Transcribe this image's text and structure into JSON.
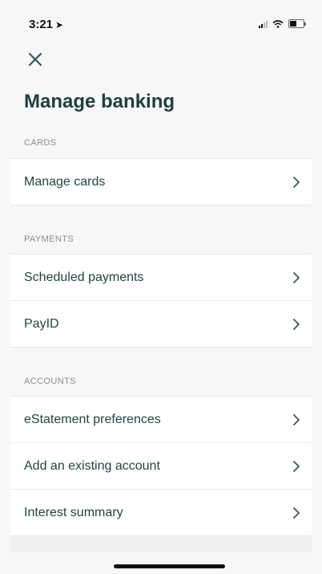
{
  "status_bar": {
    "time": "3:21",
    "location_arrow": "➤"
  },
  "header": {
    "close_icon": "close-icon",
    "title": "Manage banking"
  },
  "sections": {
    "cards": {
      "label": "CARDS",
      "items": [
        {
          "label": "Manage cards"
        }
      ]
    },
    "payments": {
      "label": "PAYMENTS",
      "items": [
        {
          "label": "Scheduled payments"
        },
        {
          "label": "PayID"
        }
      ]
    },
    "accounts": {
      "label": "ACCOUNTS",
      "items": [
        {
          "label": "eStatement preferences"
        },
        {
          "label": "Add an existing account"
        },
        {
          "label": "Interest summary"
        }
      ]
    }
  },
  "colors": {
    "accent": "#1e3f3f",
    "background": "#f7f7f7",
    "section_label": "#8a8f8f"
  }
}
